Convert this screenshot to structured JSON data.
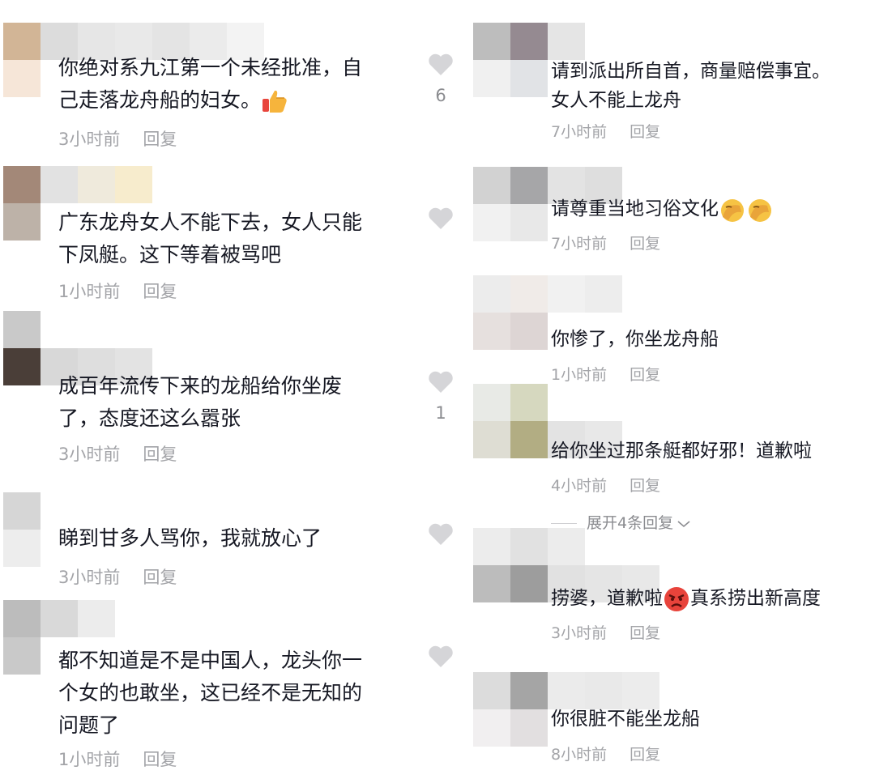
{
  "left_column": [
    {
      "lines": [
        "你绝对系九江第一个未经批准，自",
        "己走落龙舟船的妇女。"
      ],
      "emoji": "thumbs-up",
      "time": "3小时前",
      "reply": "回复",
      "likes": "6"
    },
    {
      "lines": [
        "广东龙舟女人不能下去，女人只能",
        "下凤艇。这下等着被骂吧"
      ],
      "time": "1小时前",
      "reply": "回复",
      "likes": ""
    },
    {
      "lines": [
        "成百年流传下来的龙船给你坐废",
        "了，态度还这么嚣张"
      ],
      "time": "3小时前",
      "reply": "回复",
      "likes": "1"
    },
    {
      "lines": [
        "睇到甘多人骂你，我就放心了"
      ],
      "time": "3小时前",
      "reply": "回复",
      "likes": ""
    },
    {
      "lines": [
        "都不知道是不是中国人，龙头你一",
        "个女的也敢坐，这已经不是无知的",
        "问题了"
      ],
      "time": "1小时前",
      "reply": "回复",
      "likes": ""
    }
  ],
  "right_column": [
    {
      "lines": [
        "请到派出所自首，商量赔偿事宜。",
        "女人不能上龙舟"
      ],
      "time": "7小时前",
      "reply": "回复"
    },
    {
      "text": "请尊重当地习俗文化",
      "emoji": "facepalm-x2",
      "time": "7小时前",
      "reply": "回复"
    },
    {
      "lines": [
        "你惨了，你坐龙舟船"
      ],
      "time": "1小时前",
      "reply": "回复"
    },
    {
      "lines": [
        "给你坐过那条艇都好邪！道歉啦"
      ],
      "time": "4小时前",
      "reply": "回复"
    },
    {
      "text_before": "捞婆，道歉啦",
      "emoji": "angry-face",
      "text_after": "真系捞出新高度",
      "time": "3小时前",
      "reply": "回复"
    },
    {
      "lines": [
        "你很脏不能坐龙船"
      ],
      "time": "8小时前",
      "reply": "回复"
    }
  ],
  "expand_replies": "展开4条回复",
  "expand_icon": "chevron-down-icon",
  "like_icon": "heart-icon",
  "colors": {
    "text": "#161823",
    "meta": "#a3a4a8",
    "heart": "#d5d5d8"
  }
}
